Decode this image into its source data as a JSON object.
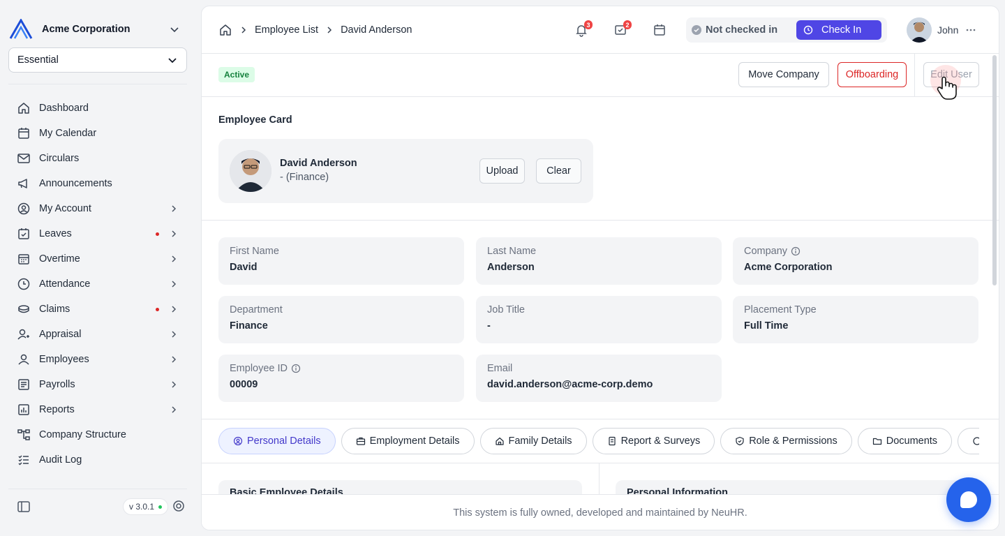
{
  "sidebar": {
    "org_name": "Acme Corporation",
    "plan": "Essential",
    "items": [
      {
        "label": "Dashboard",
        "icon": "home-icon",
        "chevron": false,
        "dot": false
      },
      {
        "label": "My Calendar",
        "icon": "calendar-icon",
        "chevron": false,
        "dot": false
      },
      {
        "label": "Circulars",
        "icon": "mail-icon",
        "chevron": false,
        "dot": false
      },
      {
        "label": "Announcements",
        "icon": "megaphone-icon",
        "chevron": false,
        "dot": false
      },
      {
        "label": "My Account",
        "icon": "user-circle-icon",
        "chevron": true,
        "dot": false
      },
      {
        "label": "Leaves",
        "icon": "calendar-check-icon",
        "chevron": true,
        "dot": true
      },
      {
        "label": "Overtime",
        "icon": "calendar-grid-icon",
        "chevron": true,
        "dot": false
      },
      {
        "label": "Attendance",
        "icon": "clock-icon",
        "chevron": true,
        "dot": false
      },
      {
        "label": "Claims",
        "icon": "coins-icon",
        "chevron": true,
        "dot": true
      },
      {
        "label": "Appraisal",
        "icon": "user-star-icon",
        "chevron": true,
        "dot": false
      },
      {
        "label": "Employees",
        "icon": "user-icon",
        "chevron": true,
        "dot": false
      },
      {
        "label": "Payrolls",
        "icon": "list-box-icon",
        "chevron": true,
        "dot": false
      },
      {
        "label": "Reports",
        "icon": "chart-box-icon",
        "chevron": true,
        "dot": false
      },
      {
        "label": "Company Structure",
        "icon": "hierarchy-icon",
        "chevron": false,
        "dot": false
      },
      {
        "label": "Audit Log",
        "icon": "checklist-icon",
        "chevron": false,
        "dot": false
      }
    ],
    "version": "v 3.0.1"
  },
  "topbar": {
    "breadcrumb": [
      "Employee List",
      "David Anderson"
    ],
    "notifications_count": "3",
    "tasks_count": "2",
    "checkin_status": "Not checked in",
    "checkin_button": "Check In",
    "user_name": "John"
  },
  "actions": {
    "status": "Active",
    "move_company": "Move Company",
    "offboarding": "Offboarding",
    "edit_user": "Edit User"
  },
  "employee_card": {
    "title": "Employee Card",
    "name": "David Anderson",
    "dept": "- (Finance)",
    "upload": "Upload",
    "clear": "Clear"
  },
  "fields": {
    "first_name": {
      "label": "First Name",
      "value": "David"
    },
    "last_name": {
      "label": "Last Name",
      "value": "Anderson"
    },
    "company": {
      "label": "Company",
      "value": "Acme Corporation"
    },
    "department": {
      "label": "Department",
      "value": "Finance"
    },
    "job_title": {
      "label": "Job Title",
      "value": "-"
    },
    "placement": {
      "label": "Placement Type",
      "value": "Full Time"
    },
    "employee_id": {
      "label": "Employee ID",
      "value": "00009"
    },
    "email": {
      "label": "Email",
      "value": "david.anderson@acme-corp.demo"
    }
  },
  "tabs": [
    "Personal Details",
    "Employment Details",
    "Family Details",
    "Report & Surveys",
    "Role & Permissions",
    "Documents"
  ],
  "lower": {
    "left_title": "Basic Employee Details",
    "right_title": "Personal Information"
  },
  "footer": "This system is fully owned, developed and maintained by NeuHR.",
  "colors": {
    "accent": "#4f46e5",
    "danger": "#dc2626",
    "success": "#15803d",
    "chat": "#2563eb"
  }
}
